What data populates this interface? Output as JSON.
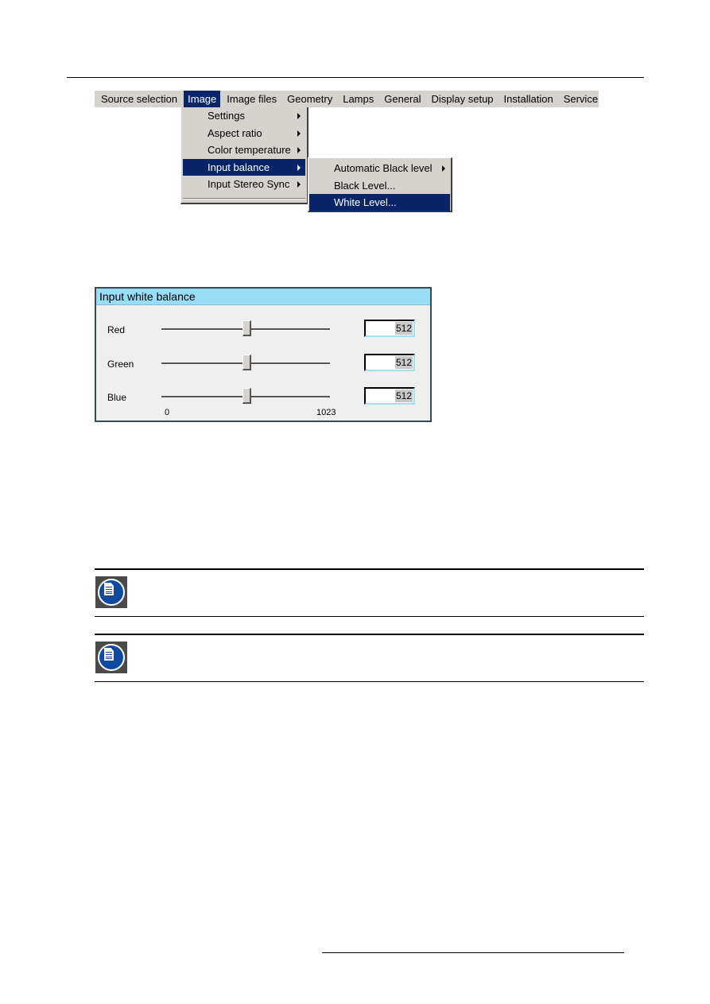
{
  "menubar": {
    "items": [
      "Source selection",
      "Image",
      "Image files",
      "Geometry",
      "Lamps",
      "General",
      "Display setup",
      "Installation",
      "Service"
    ],
    "active": "Image"
  },
  "image_menu": {
    "items": [
      {
        "label": "Settings",
        "has_submenu": true
      },
      {
        "label": "Aspect ratio",
        "has_submenu": true
      },
      {
        "label": "Color temperature",
        "has_submenu": true
      },
      {
        "label": "Input balance",
        "has_submenu": true,
        "active": true
      },
      {
        "label": "Input Stereo Sync",
        "has_submenu": true
      }
    ]
  },
  "input_balance_menu": {
    "items": [
      {
        "label": "Automatic Black level",
        "has_submenu": true
      },
      {
        "label": "Black Level...",
        "has_submenu": false
      },
      {
        "label": "White Level...",
        "has_submenu": false,
        "active": true
      }
    ]
  },
  "dialog": {
    "title": "Input white balance",
    "sliders": [
      {
        "label": "Red",
        "value": "512",
        "fraction": 0.5
      },
      {
        "label": "Green",
        "value": "512",
        "fraction": 0.5
      },
      {
        "label": "Blue",
        "value": "512",
        "fraction": 0.5
      }
    ],
    "scale_min": "0",
    "scale_max": "1023"
  },
  "colors": {
    "menu_bg": "#d6d3ce",
    "highlight": "#0a246a",
    "dialog_title_bg": "#99dcf5",
    "note_icon_blue": "#0d4aa0"
  },
  "notes": [
    {
      "icon": "note-document-icon"
    },
    {
      "icon": "note-document-icon"
    }
  ]
}
